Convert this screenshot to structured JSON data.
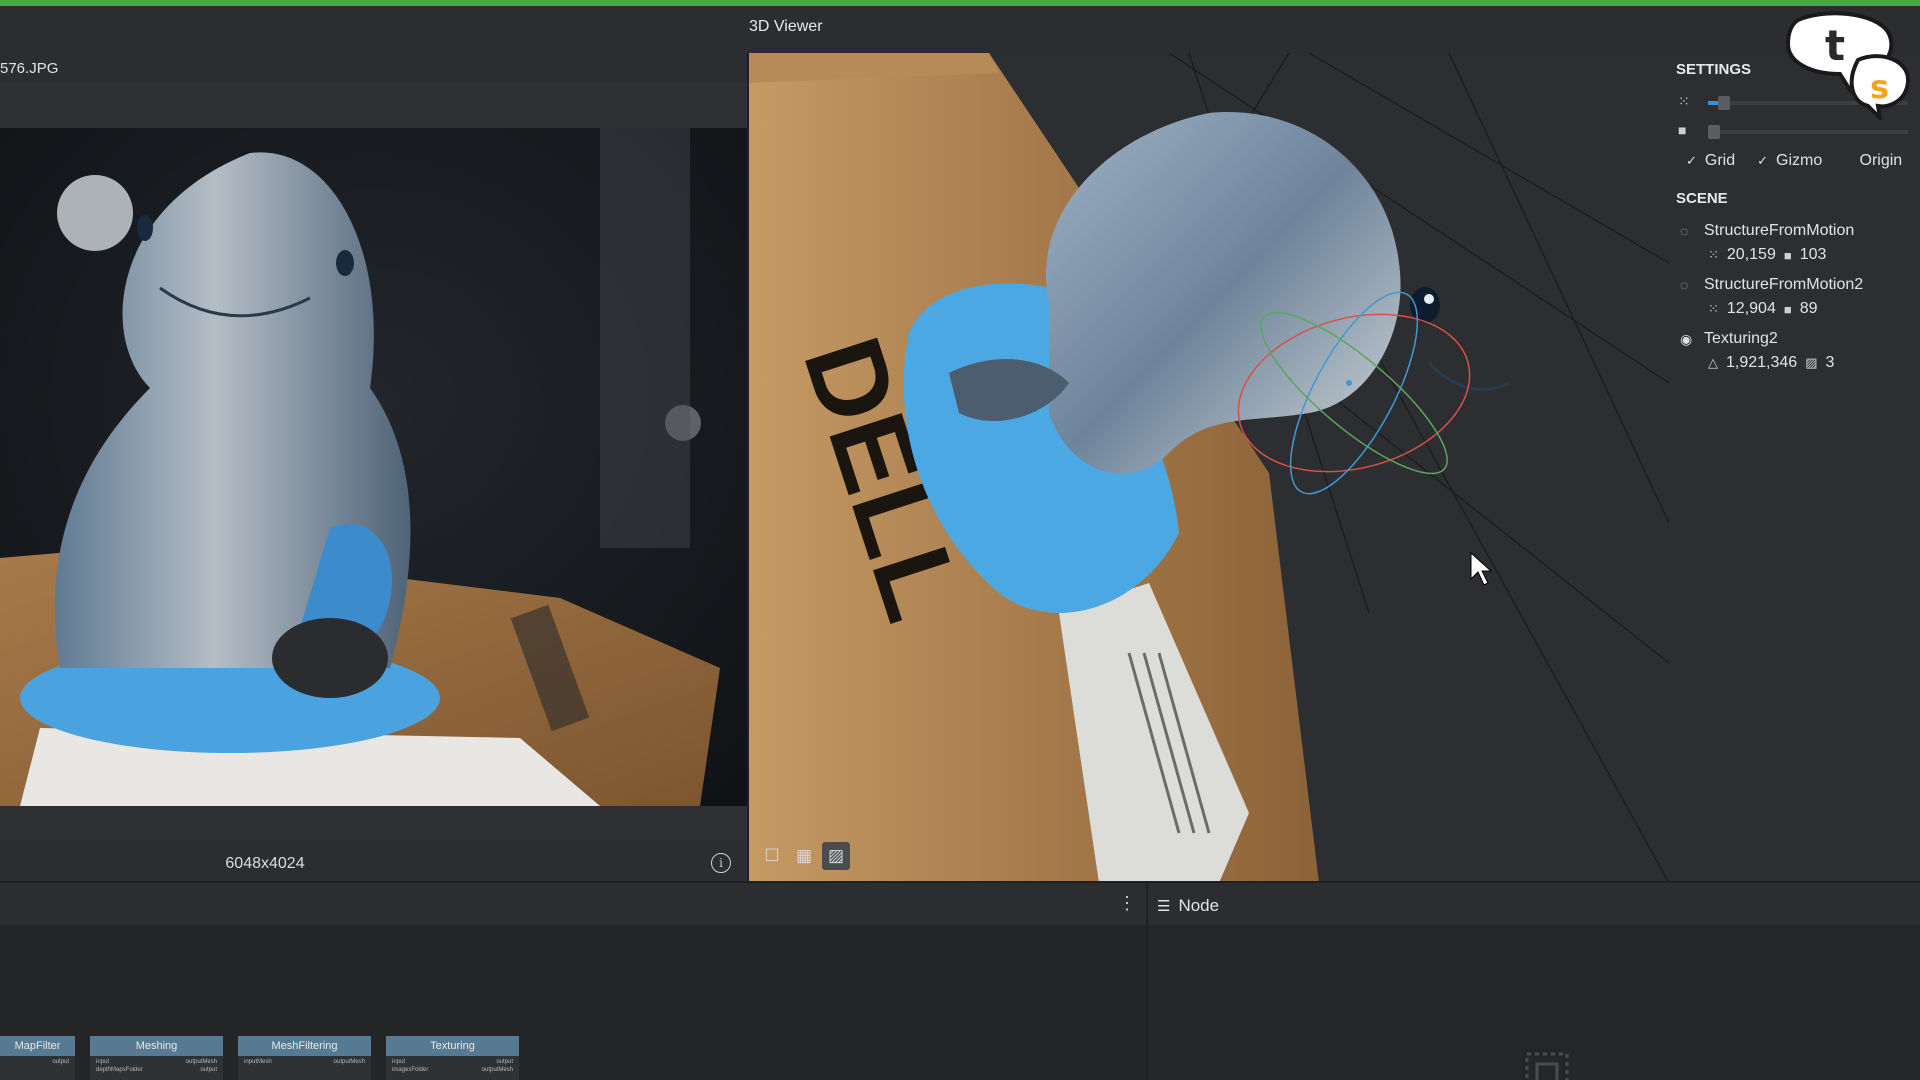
{
  "colors": {
    "accent_green": "#4aa648",
    "node_header": "#557a92",
    "slider_blue": "#3b8fd9"
  },
  "image_viewer": {
    "title": "576.JPG",
    "resolution": "6048x4024",
    "info_icon": "info-icon"
  },
  "viewer3d": {
    "header": "3D Viewer",
    "tools": [
      {
        "icon": "square-icon",
        "glyph": "☐"
      },
      {
        "icon": "grid-icon",
        "glyph": "▦"
      },
      {
        "icon": "texture-hatch-icon",
        "glyph": "▨"
      }
    ]
  },
  "settings": {
    "title": "SETTINGS",
    "sliders": [
      {
        "icon": "points-icon",
        "glyph": "⁙",
        "value": 0.05
      },
      {
        "icon": "camera-icon",
        "glyph": "■",
        "value": 0.0
      }
    ],
    "toggles": [
      {
        "label": "Grid",
        "checked": true
      },
      {
        "label": "Gizmo",
        "checked": true
      },
      {
        "label": "Origin",
        "checked": false
      }
    ]
  },
  "scene": {
    "title": "SCENE",
    "items": [
      {
        "name": "StructureFromMotion",
        "visible": false,
        "stat1_icon": "points-icon",
        "stat1": "20,159",
        "stat2_icon": "camera-icon",
        "stat2": "103"
      },
      {
        "name": "StructureFromMotion2",
        "visible": false,
        "stat1_icon": "points-icon",
        "stat1": "12,904",
        "stat2_icon": "camera-icon",
        "stat2": "89"
      },
      {
        "name": "Texturing2",
        "visible": true,
        "stat1_icon": "triangle-icon",
        "stat1": "1,921,346",
        "stat2_icon": "texture-icon",
        "stat2": "3"
      }
    ]
  },
  "logo": {
    "letter1": "t",
    "letter2": "s"
  },
  "graph": {
    "menu_icon": "more-vertical-icon",
    "nodes": [
      {
        "label": "MapFilter",
        "in": "output",
        "out": ""
      },
      {
        "label": "Meshing",
        "in": "input\ndepthMapsFolder",
        "out": "outputMesh\noutput"
      },
      {
        "label": "MeshFiltering",
        "in": "inputMesh",
        "out": "outputMesh"
      },
      {
        "label": "Texturing",
        "in": "input\nimagesFolder",
        "out": "output\noutputMesh"
      }
    ]
  },
  "node_panel": {
    "title": "Node",
    "icon": "sliders-icon"
  }
}
